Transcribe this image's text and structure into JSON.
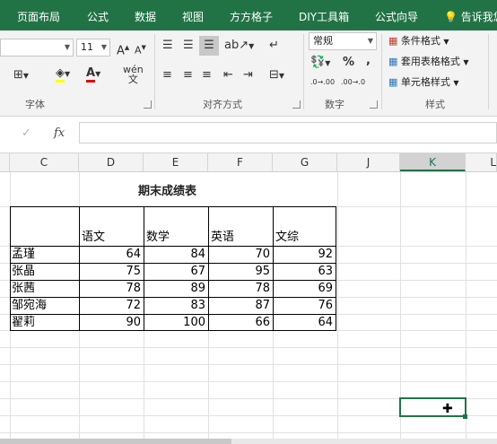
{
  "ribbon_tabs": [
    "页面布局",
    "公式",
    "数据",
    "视图",
    "方方格子",
    "DIY工具箱",
    "公式向导"
  ],
  "tell_me": "告诉我您",
  "font": {
    "size_value": "11",
    "group_label": "字体",
    "phonetic_top": "wén",
    "phonetic_bottom": "文"
  },
  "alignment": {
    "group_label": "对齐方式"
  },
  "number": {
    "format_value": "常规",
    "percent_symbol": "%",
    "comma_symbol": ",",
    "group_label": "数字",
    "inc_decimal": ".0→.00",
    "dec_decimal": ".00→.0"
  },
  "styles": {
    "conditional_format": "条件格式",
    "format_as_table": "套用表格格式",
    "cell_styles": "单元格样式",
    "group_label": "样式"
  },
  "formula_bar": {
    "cancel_symbol": "✓",
    "fx_symbol": "fx",
    "content": ""
  },
  "columns": [
    "C",
    "D",
    "E",
    "F",
    "G",
    "J",
    "K",
    "L"
  ],
  "selected_column": "K",
  "table": {
    "title": "期末成绩表",
    "headers": [
      "语文",
      "数学",
      "英语",
      "文综"
    ],
    "rows": [
      {
        "name": "孟瑾",
        "scores": [
          64,
          84,
          70,
          92
        ]
      },
      {
        "name": "张晶",
        "scores": [
          75,
          67,
          95,
          63
        ]
      },
      {
        "name": "张茜",
        "scores": [
          78,
          89,
          78,
          69
        ]
      },
      {
        "name": "邹宛海",
        "scores": [
          72,
          83,
          87,
          76
        ]
      },
      {
        "name": "翟莉",
        "scores": [
          90,
          100,
          66,
          64
        ]
      }
    ]
  },
  "accent_color": "#217346"
}
